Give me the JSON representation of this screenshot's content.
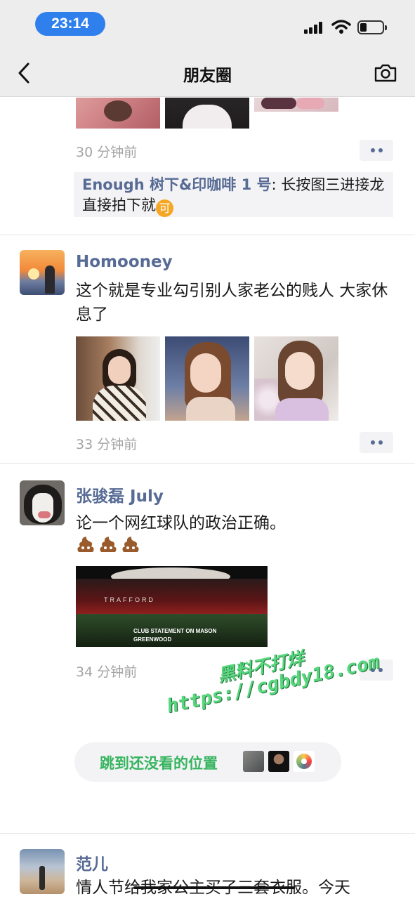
{
  "status_bar": {
    "time": "23:14"
  },
  "nav": {
    "title": "朋友圈"
  },
  "post1": {
    "time": "30 分钟前",
    "comment": {
      "author": "Enough 树下&印咖啡 1 号",
      "separator": ": ",
      "text": "长按图三进接龙直接拍下就",
      "emoji": "可"
    }
  },
  "post2": {
    "name": "Homooney",
    "text": "这个就是专业勾引别人家老公的贱人 大家休息了",
    "time": "33 分钟前"
  },
  "post3": {
    "name": "张骏磊 July",
    "text": "论一个网红球队的政治正确。",
    "image_caption_line1": "CLUB STATEMENT ON MASON",
    "image_caption_line2": "GREENWOOD",
    "stadium_sign": "TRAFFORD",
    "time": "34 分钟前"
  },
  "jump": {
    "label": "跳到还没看的位置"
  },
  "watermark": {
    "line1": "黑料不打烊",
    "line2": "https://cgbdy18.com"
  },
  "post4": {
    "name": "范儿",
    "text": "情人节给我家公主买了三套衣服。今天"
  }
}
